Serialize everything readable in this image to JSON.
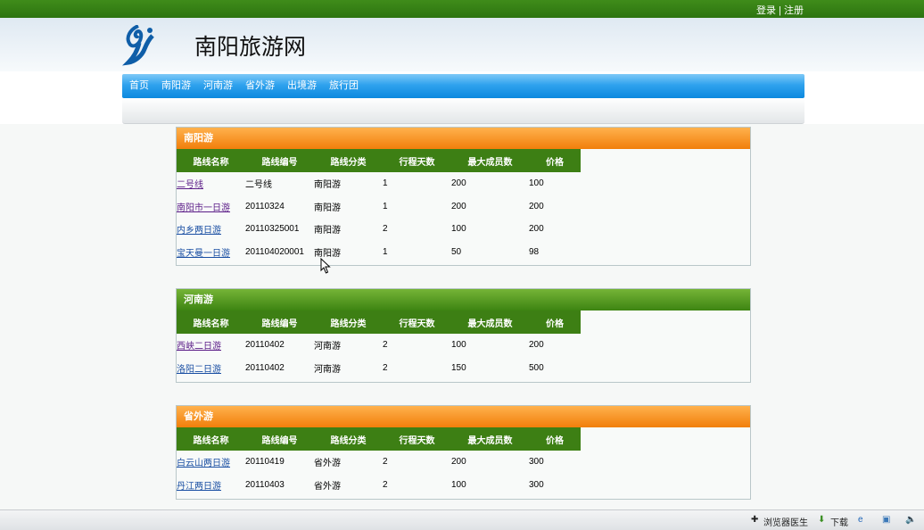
{
  "top": {
    "login": "登录",
    "sep": "|",
    "register": "注册"
  },
  "site": {
    "title": "南阳旅游网"
  },
  "nav": [
    "首页",
    "南阳游",
    "河南游",
    "省外游",
    "出境游",
    "旅行团"
  ],
  "columns": [
    "路线名称",
    "路线编号",
    "路线分类",
    "行程天数",
    "最大成员数",
    "价格"
  ],
  "sections": [
    {
      "title": "南阳游",
      "rows": [
        [
          "二号线",
          "二号线",
          "南阳游",
          "1",
          "200",
          "100"
        ],
        [
          "南阳市一日游",
          "20110324",
          "南阳游",
          "1",
          "200",
          "200"
        ],
        [
          "内乡两日游",
          "20110325001",
          "南阳游",
          "2",
          "100",
          "200"
        ],
        [
          "宝天曼一日游",
          "201104020001",
          "南阳游",
          "1",
          "50",
          "98"
        ]
      ]
    },
    {
      "title": "河南游",
      "rows": [
        [
          "西峡二日游",
          "20110402",
          "河南游",
          "2",
          "100",
          "200"
        ],
        [
          "洛阳二日游",
          "20110402",
          "河南游",
          "2",
          "150",
          "500"
        ]
      ]
    },
    {
      "title": "省外游",
      "rows": [
        [
          "白云山两日游",
          "20110419",
          "省外游",
          "2",
          "200",
          "300"
        ],
        [
          "丹江两日游",
          "20110403",
          "省外游",
          "2",
          "100",
          "300"
        ]
      ]
    }
  ],
  "status": {
    "doctor": "浏览器医生",
    "download": "下载"
  }
}
